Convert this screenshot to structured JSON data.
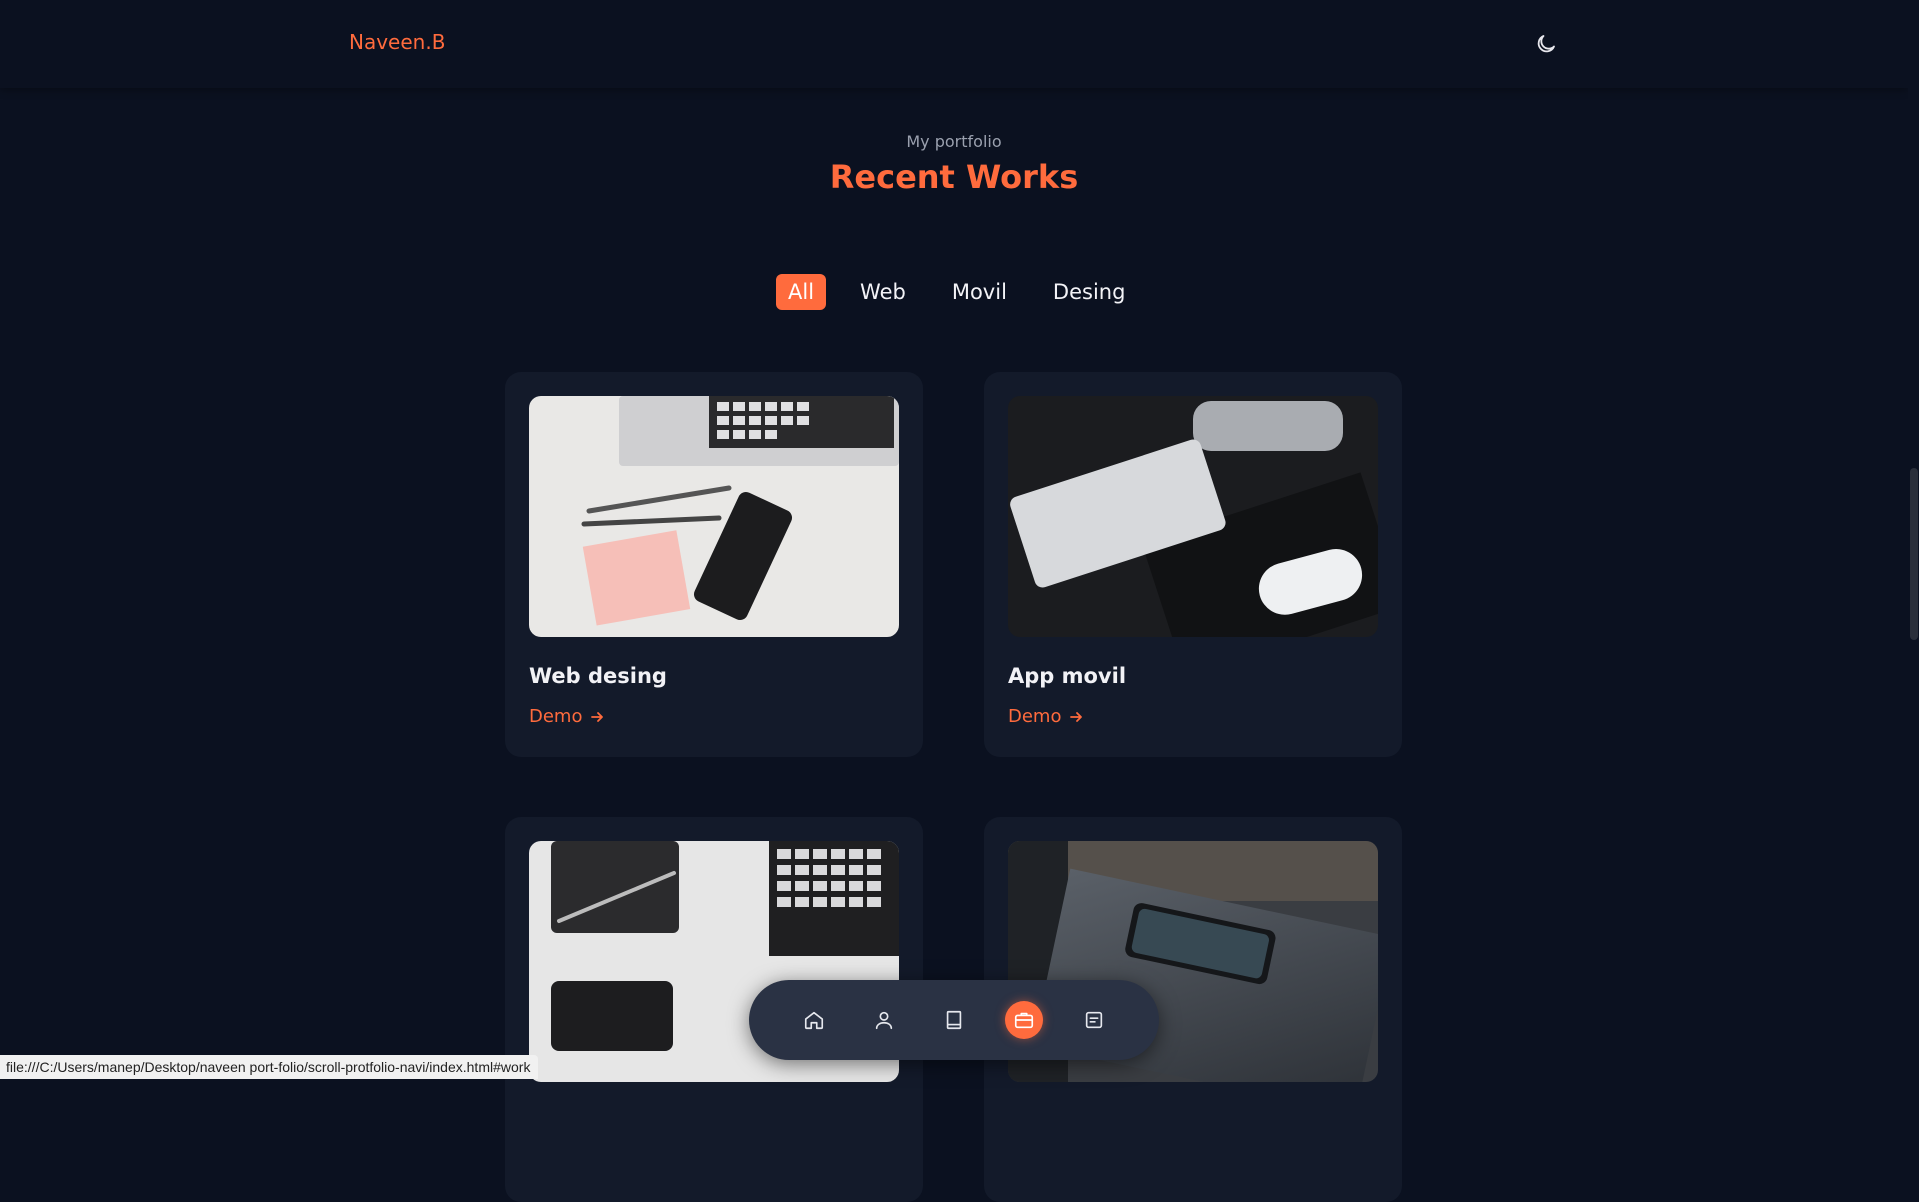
{
  "header": {
    "logo": "Naveen.B",
    "theme_icon": "moon-icon"
  },
  "section": {
    "subtitle": "My portfolio",
    "title": "Recent Works"
  },
  "filters": [
    {
      "label": "All",
      "active": true
    },
    {
      "label": "Web",
      "active": false
    },
    {
      "label": "Movil",
      "active": false
    },
    {
      "label": "Desing",
      "active": false
    }
  ],
  "cards": [
    {
      "title": "Web desing",
      "link": "Demo",
      "image": "laptop-pens-phone-photo"
    },
    {
      "title": "App movil",
      "link": "Demo",
      "image": "keyboard-mouse-photo"
    },
    {
      "title": "",
      "link": "",
      "image": "notebook-pen-laptop-photo"
    },
    {
      "title": "",
      "link": "",
      "image": "phone-on-laptop-photo"
    }
  ],
  "bottom_nav": [
    {
      "icon": "home-icon",
      "active": false
    },
    {
      "icon": "user-icon",
      "active": false
    },
    {
      "icon": "book-icon",
      "active": false
    },
    {
      "icon": "briefcase-icon",
      "active": true
    },
    {
      "icon": "message-icon",
      "active": false
    }
  ],
  "status_bar": {
    "url": "file:///C:/Users/manep/Desktop/naveen port-folio/scroll-protfolio-navi/index.html#work"
  },
  "colors": {
    "background": "#0b1120",
    "card": "#131a2a",
    "accent": "#ff6b3d",
    "nav": "#2a3244"
  }
}
